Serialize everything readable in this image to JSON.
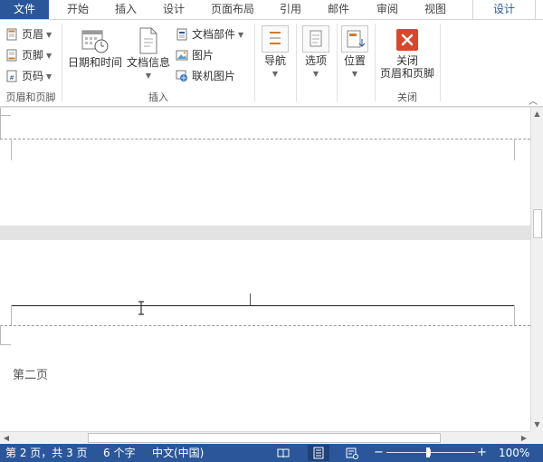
{
  "tabs": [
    {
      "label": "文件"
    },
    {
      "label": "开始"
    },
    {
      "label": "插入"
    },
    {
      "label": "设计"
    },
    {
      "label": "页面布局"
    },
    {
      "label": "引用"
    },
    {
      "label": "邮件"
    },
    {
      "label": "审阅"
    },
    {
      "label": "视图"
    },
    {
      "label": "设计"
    }
  ],
  "ribbon": {
    "header_footer": {
      "header": "页眉",
      "footer": "页脚",
      "page_number": "页码",
      "group": "页眉和页脚"
    },
    "insert": {
      "date_time": "日期和时间",
      "doc_info": "文档信息",
      "doc_parts": "文档部件",
      "picture": "图片",
      "online_picture": "联机图片",
      "group": "插入"
    },
    "navigation": "导航",
    "options": "选项",
    "position": "位置",
    "close": {
      "line1": "关闭",
      "line2": "页眉和页脚",
      "group": "关闭"
    }
  },
  "document": {
    "footer_label": "第二页"
  },
  "status": {
    "page": "第 2 页，共 3 页",
    "words": "6 个字",
    "language": "中文(中国)",
    "zoom": "100%",
    "zoom_fraction": 0.47
  },
  "colors": {
    "accent": "#2b579a",
    "close_red": "#d9472b"
  }
}
